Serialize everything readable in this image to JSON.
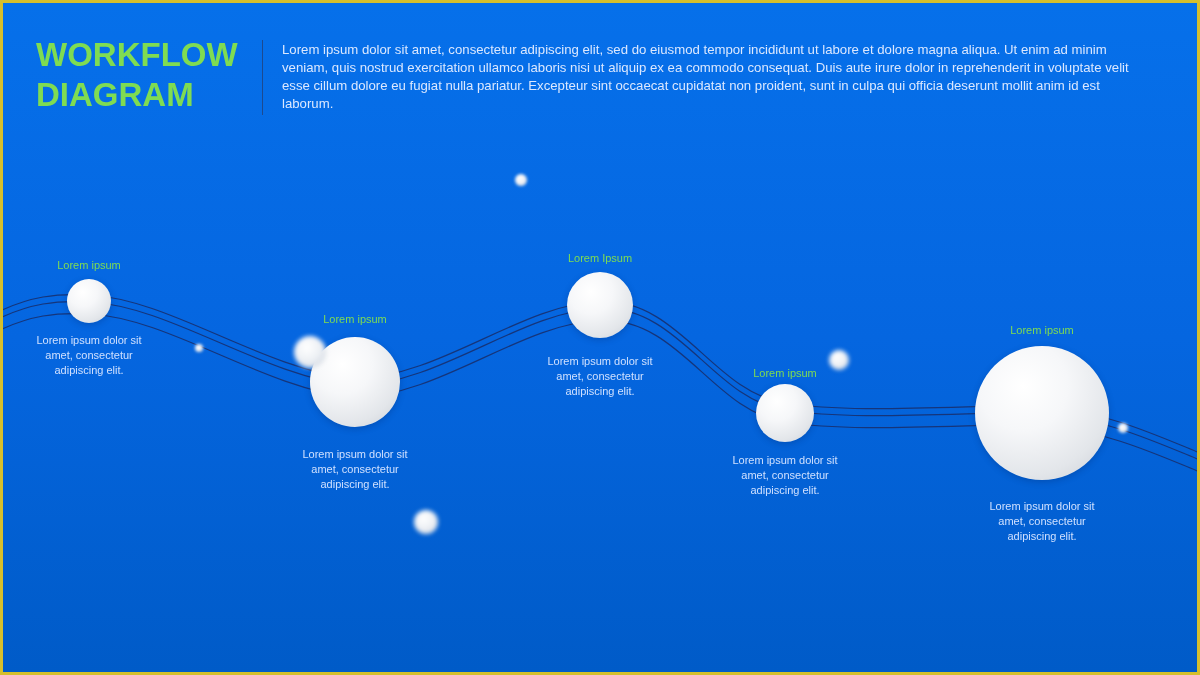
{
  "title": "WORKFLOW DIAGRAM",
  "description": "Lorem ipsum dolor sit amet, consectetur adipiscing elit, sed do eiusmod tempor incididunt ut labore et dolore magna aliqua. Ut enim ad minim veniam, quis nostrud exercitation ullamco laboris nisi ut aliquip ex ea commodo consequat. Duis aute irure dolor in reprehenderit in voluptate velit esse cillum dolore eu fugiat nulla pariatur. Excepteur sint occaecat cupidatat non proident, sunt in culpa qui officia deserunt mollit anim id est laborum.",
  "steps": [
    {
      "label": "Lorem ipsum",
      "text": "Lorem ipsum dolor sit amet, consectetur adipiscing elit."
    },
    {
      "label": "Lorem ipsum",
      "text": "Lorem ipsum dolor sit amet, consectetur adipiscing elit."
    },
    {
      "label": "Lorem Ipsum",
      "text": "Lorem ipsum dolor sit amet, consectetur adipiscing elit."
    },
    {
      "label": "Lorem ipsum",
      "text": "Lorem ipsum dolor sit amet, consectetur adipiscing elit."
    },
    {
      "label": "Lorem ipsum",
      "text": "Lorem ipsum dolor sit amet, consectetur adipiscing elit."
    }
  ]
}
